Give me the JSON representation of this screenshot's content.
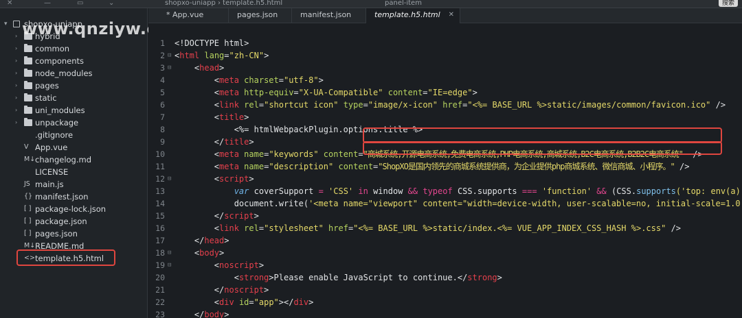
{
  "topbar": {
    "crumbs": "shopxo-uniapp › template.h5.html",
    "search": "panel-item",
    "button": "搜索"
  },
  "watermark": "www.qnziyw.cn",
  "sidebar": {
    "root": "shopxo-uniapp",
    "items": [
      {
        "label": "hybrid",
        "type": "folder",
        "icon_text": ""
      },
      {
        "label": "common",
        "type": "folder",
        "icon_text": ""
      },
      {
        "label": "components",
        "type": "folder",
        "icon_text": ""
      },
      {
        "label": "node_modules",
        "type": "folder",
        "icon_text": ""
      },
      {
        "label": "pages",
        "type": "folder",
        "icon_text": ""
      },
      {
        "label": "static",
        "type": "folder",
        "icon_text": ""
      },
      {
        "label": "uni_modules",
        "type": "folder",
        "icon_text": ""
      },
      {
        "label": "unpackage",
        "type": "folder",
        "icon_text": ""
      },
      {
        "label": ".gitignore",
        "type": "file",
        "icon_text": ""
      },
      {
        "label": "App.vue",
        "type": "file",
        "icon_text": "V"
      },
      {
        "label": "changelog.md",
        "type": "file",
        "icon_text": "M↓"
      },
      {
        "label": "LICENSE",
        "type": "file",
        "icon_text": ""
      },
      {
        "label": "main.js",
        "type": "file",
        "icon_text": "JS"
      },
      {
        "label": "manifest.json",
        "type": "file",
        "icon_text": "{}"
      },
      {
        "label": "package-lock.json",
        "type": "file",
        "icon_text": "[ ]"
      },
      {
        "label": "package.json",
        "type": "file",
        "icon_text": "[ ]"
      },
      {
        "label": "pages.json",
        "type": "file",
        "icon_text": "[ ]"
      },
      {
        "label": "README.md",
        "type": "file",
        "icon_text": "M↓"
      },
      {
        "label": "template.h5.html",
        "type": "file",
        "icon_text": "<>"
      }
    ]
  },
  "tabs": [
    {
      "label": "* App.vue"
    },
    {
      "label": "pages.json"
    },
    {
      "label": "manifest.json"
    },
    {
      "label": "template.h5.html"
    }
  ],
  "code": {
    "l1_doctype": "<!DOCTYPE html>",
    "l2_lang": "\"zh-CN\"",
    "l4_charset": "\"utf-8\"",
    "l5_equiv": "\"X-UA-Compatible\"",
    "l5_content": "\"IE=edge\"",
    "l6_rel": "\"shortcut icon\"",
    "l6_type": "\"image/x-icon\"",
    "l6_href": "\"<%= BASE_URL %>static/images/common/favicon.ico\"",
    "l8_text": "<%= htmlWebpackPlugin.options.title %>",
    "l10_name": "\"keywords\"",
    "l10_content": "\"商城系统,开源电商系统,免费电商系统,PHP电商系统,商城系统,B2C电商系统,B2B2C电商系统\"",
    "l11_name": "\"description\"",
    "l11_content": "\"ShopXO是国内领先的商城系统提供商，为企业提供php商城系统、微信商城、小程序。\"",
    "l13_var": "var",
    "l13_ident": "coverSupport",
    "l13_css": "'CSS'",
    "l13_in": "in",
    "l13_window": "window",
    "l13_typeof": "typeof",
    "l13_supports": "CSS.supports",
    "l13_function": "'function'",
    "l13_tail": "(CSS.",
    "l13_supports2": "supports",
    "l13_top": "('top: env(a)",
    "l14_doc": "document.write(",
    "l14_str": "'<meta name=\"viewport\" content=\"width=device-width, user-scalable=no, initial-scale=1.0",
    "l16_rel": "\"stylesheet\"",
    "l16_href": "\"<%= BASE_URL %>static/index.<%= VUE_APP_INDEX_CSS_HASH %>.css\"",
    "l20_text": "Please enable JavaScript to continue.",
    "l22_id": "\"app\""
  }
}
